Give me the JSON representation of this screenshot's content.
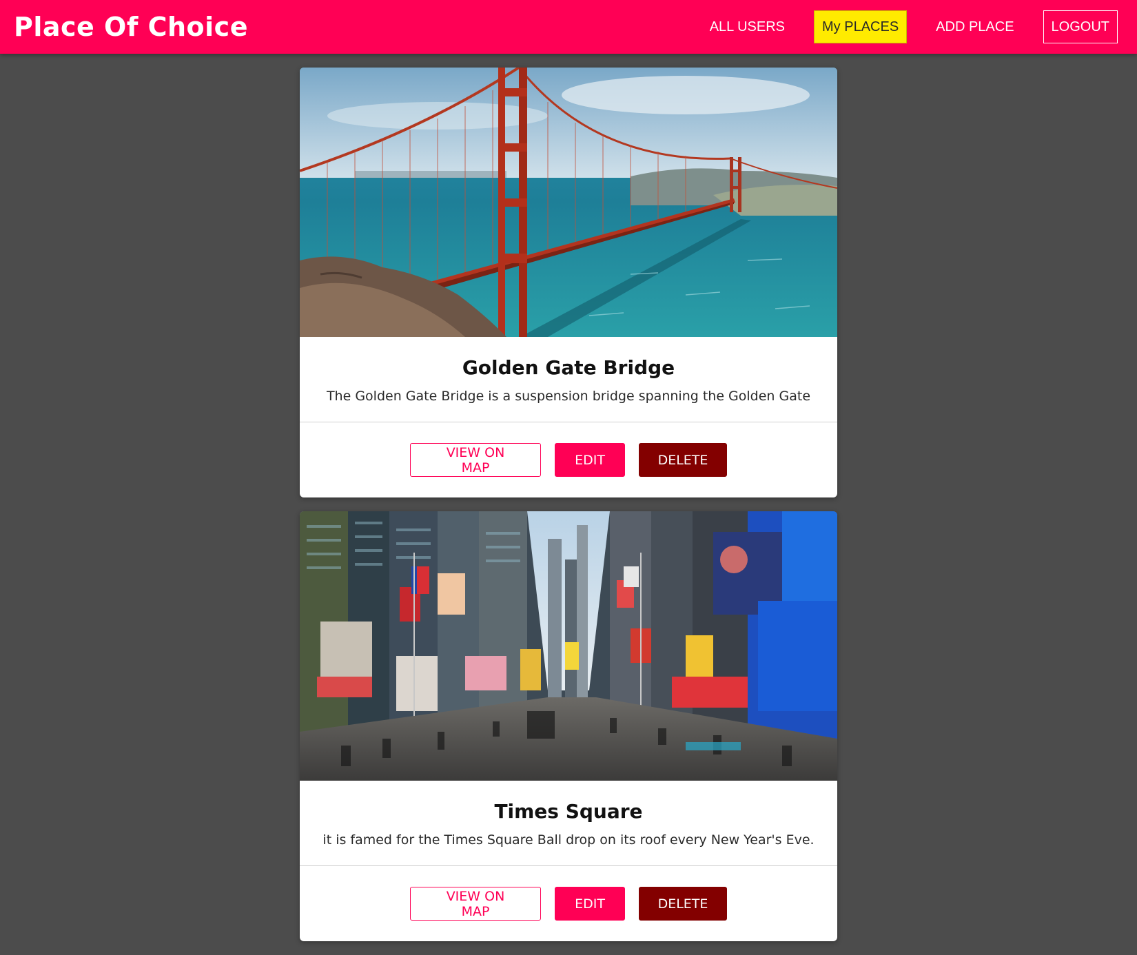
{
  "header": {
    "title": "Place Of Choice",
    "nav": {
      "all_users": "ALL USERS",
      "my_places": "My PLACES",
      "add_place": "ADD PLACE",
      "logout": "LOGOUT"
    }
  },
  "colors": {
    "brand": "#ff0055",
    "active_nav": "#ffeb00",
    "danger": "#830000",
    "background": "#4c4c4c"
  },
  "places": [
    {
      "title": "Golden Gate Bridge",
      "description": "The Golden Gate Bridge is a suspension bridge spanning the Golden Gate",
      "image": "golden-gate-bridge-photo",
      "actions": {
        "view": "VIEW ON MAP",
        "edit": "EDIT",
        "delete": "DELETE"
      }
    },
    {
      "title": "Times Square",
      "description": "it is famed for the Times Square Ball drop on its roof every New Year's Eve.",
      "image": "times-square-photo",
      "actions": {
        "view": "VIEW ON MAP",
        "edit": "EDIT",
        "delete": "DELETE"
      }
    }
  ]
}
